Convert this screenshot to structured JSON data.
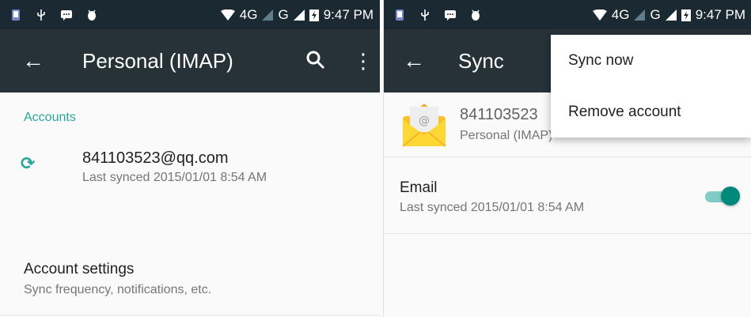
{
  "status_bar": {
    "network_4g": "4G",
    "network_g": "G",
    "time": "9:47 PM"
  },
  "left_screen": {
    "title": "Personal (IMAP)",
    "section_header": "Accounts",
    "account": {
      "email": "841103523@qq.com",
      "last_synced": "Last synced 2015/01/01 8:54 AM"
    },
    "account_settings": {
      "title": "Account settings",
      "subtitle": "Sync frequency, notifications, etc."
    }
  },
  "right_screen": {
    "title": "Sync",
    "account_header": {
      "email": "841103523",
      "account_type": "Personal (IMAP)"
    },
    "email_sync": {
      "title": "Email",
      "last_synced": "Last synced 2015/01/01 8:54 AM",
      "enabled": true
    },
    "overflow_menu": {
      "items": [
        "Sync now",
        "Remove account"
      ]
    }
  },
  "colors": {
    "appbar": "#263238",
    "statusbar": "#1b2a32",
    "accent": "#26a69a",
    "toggle_on": "#00897b"
  }
}
